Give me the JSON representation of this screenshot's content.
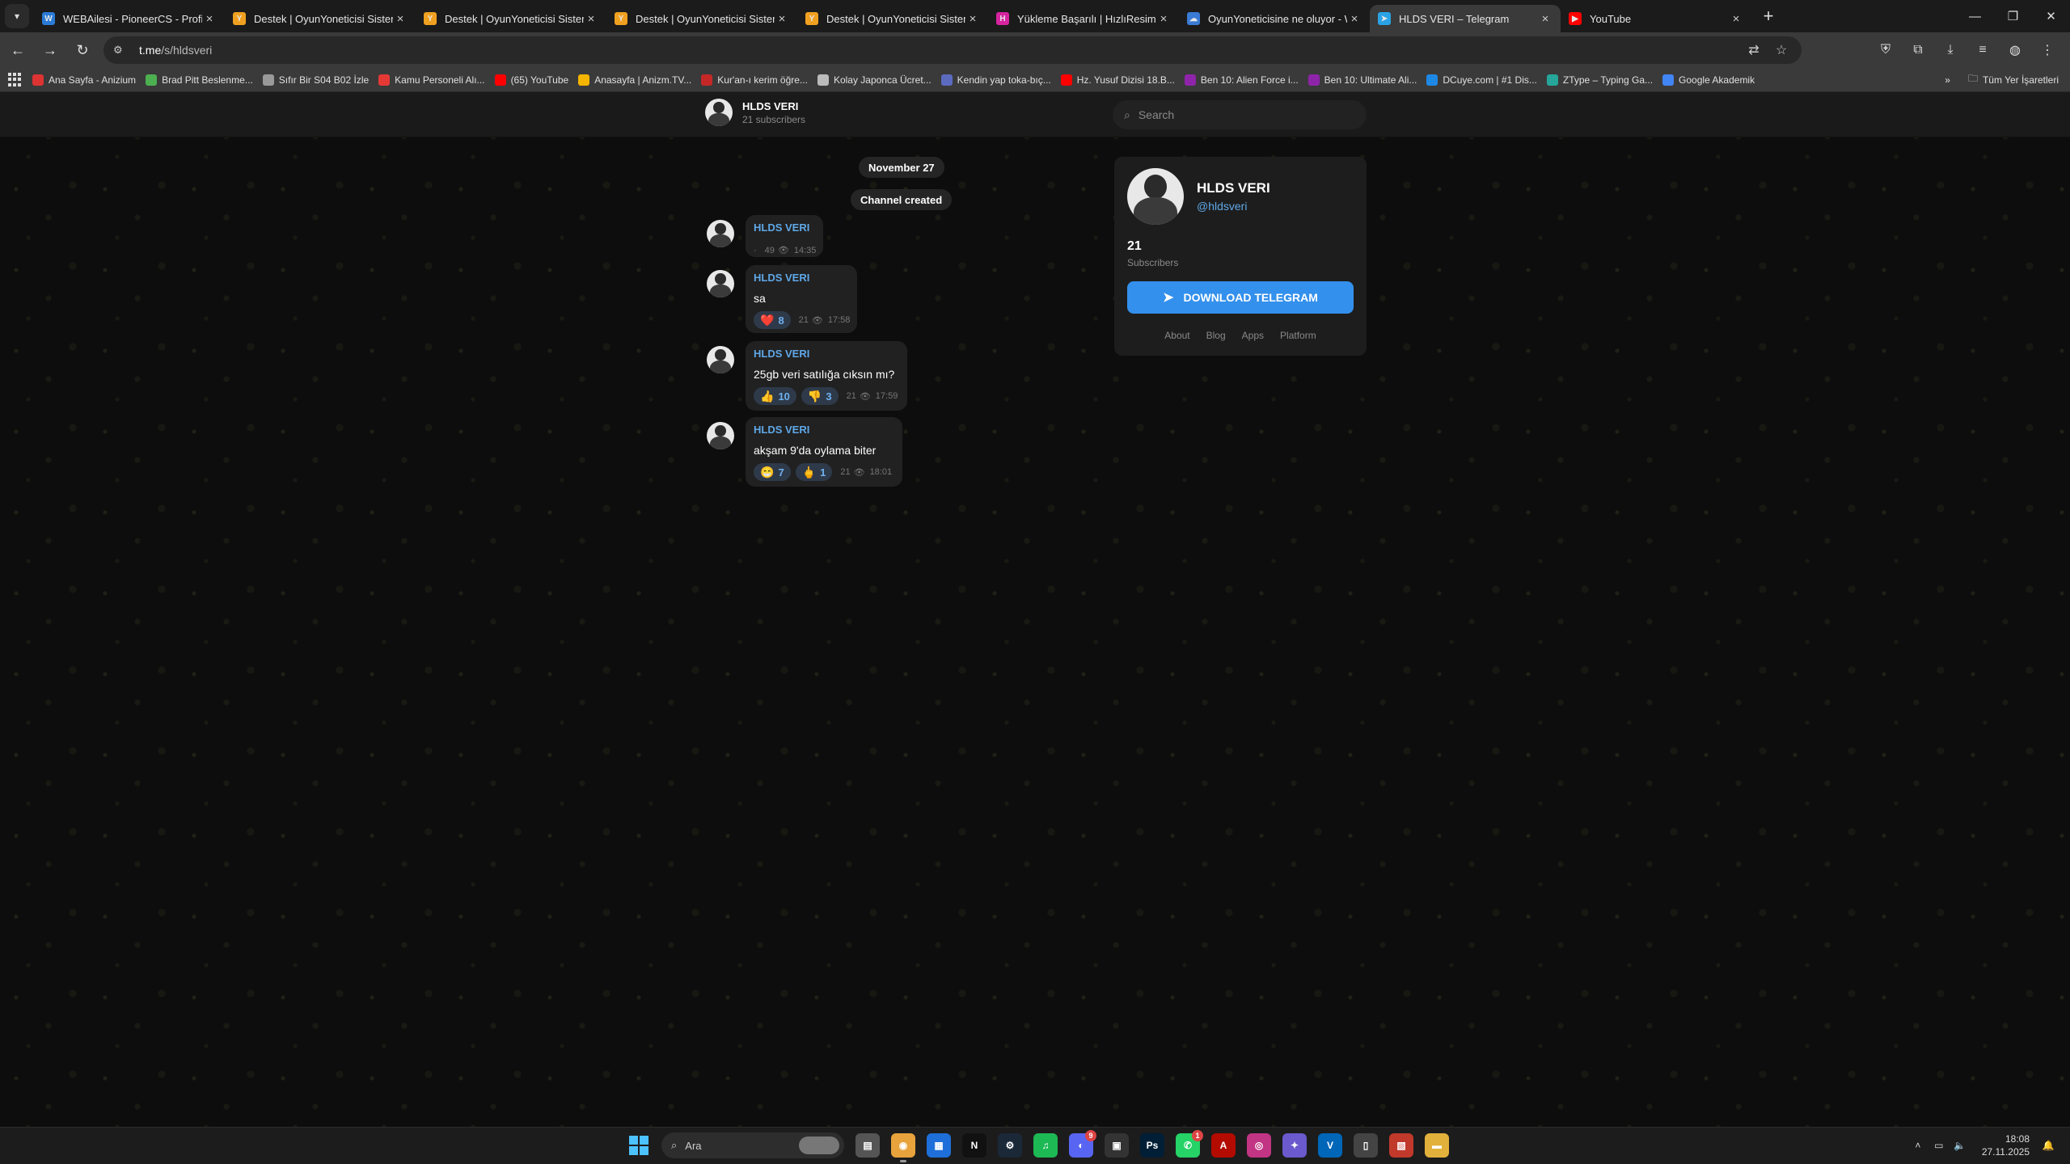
{
  "browser": {
    "tabs": [
      {
        "title": "WEBAilesi - PioneerCS - Profil S",
        "fav_color": "#2b7bd6",
        "fav_glyph": "W"
      },
      {
        "title": "Destek | OyunYoneticisi Sistemi",
        "fav_color": "#f0a020",
        "fav_glyph": "Y"
      },
      {
        "title": "Destek | OyunYoneticisi Sistemi",
        "fav_color": "#f0a020",
        "fav_glyph": "Y"
      },
      {
        "title": "Destek | OyunYoneticisi Sistemi",
        "fav_color": "#f0a020",
        "fav_glyph": "Y"
      },
      {
        "title": "Destek | OyunYoneticisi Sistemi",
        "fav_color": "#f0a020",
        "fav_glyph": "Y"
      },
      {
        "title": "Yükleme Başarılı | HızlıResim",
        "fav_color": "#d6249f",
        "fav_glyph": "H"
      },
      {
        "title": "OyunYoneticisine ne oluyor - W",
        "fav_color": "#3a7bd5",
        "fav_glyph": "☁"
      },
      {
        "title": "HLDS VERI – Telegram",
        "fav_color": "#2aa3e6",
        "fav_glyph": "➤",
        "active": true
      },
      {
        "title": "YouTube",
        "fav_color": "#ff0000",
        "fav_glyph": "▶"
      }
    ],
    "address": {
      "host": "t.me",
      "path": "/s/hldsveri"
    },
    "bookmarks": [
      {
        "label": "Ana Sayfa - Anizium",
        "color": "#d33"
      },
      {
        "label": "Brad Pitt Beslenme...",
        "color": "#4caf50"
      },
      {
        "label": "Sıfır Bir S04 B02 İzle",
        "color": "#999"
      },
      {
        "label": "Kamu Personeli Alı...",
        "color": "#e53935"
      },
      {
        "label": "(65) YouTube",
        "color": "#ff0000"
      },
      {
        "label": "Anasayfa | Anizm.TV...",
        "color": "#f4b400"
      },
      {
        "label": "Kur'an-ı kerim öğre...",
        "color": "#c62828"
      },
      {
        "label": "Kolay Japonca Ücret...",
        "color": "#bbb"
      },
      {
        "label": "Kendin yap toka-bıç...",
        "color": "#5c6bc0"
      },
      {
        "label": "Hz. Yusuf Dizisi 18.B...",
        "color": "#ff0000"
      },
      {
        "label": "Ben 10: Alien Force i...",
        "color": "#8e24aa"
      },
      {
        "label": "Ben 10: Ultimate Ali...",
        "color": "#8e24aa"
      },
      {
        "label": "DCuye.com | #1 Dis...",
        "color": "#1e88e5"
      },
      {
        "label": "ZType – Typing Ga...",
        "color": "#26a69a"
      },
      {
        "label": "Google Akademik",
        "color": "#4285f4"
      }
    ],
    "bookmarks_folder": "Tüm Yer İşaretleri"
  },
  "telegram": {
    "header": {
      "name": "HLDS VERI",
      "subscribers": "21 subscribers"
    },
    "search_placeholder": "Search",
    "date_label": "November 27",
    "service_label": "Channel created",
    "messages": [
      {
        "author": "HLDS VERI",
        "text": "",
        "reactions": [],
        "views": "49",
        "time": "14:35",
        "prefix": "·"
      },
      {
        "author": "HLDS VERI",
        "text": "sa",
        "reactions": [
          {
            "emoji": "❤️",
            "count": "8"
          }
        ],
        "views": "21",
        "time": "17:58"
      },
      {
        "author": "HLDS VERI",
        "text": "25gb veri satılığa cıksın mı?",
        "reactions": [
          {
            "emoji": "👍",
            "count": "10"
          },
          {
            "emoji": "👎",
            "count": "3"
          }
        ],
        "views": "21",
        "time": "17:59"
      },
      {
        "author": "HLDS VERI",
        "text": "akşam 9'da oylama biter",
        "reactions": [
          {
            "emoji": "😁",
            "count": "7"
          },
          {
            "emoji": "🖕",
            "count": "1"
          }
        ],
        "views": "21",
        "time": "18:01"
      }
    ],
    "card": {
      "name": "HLDS VERI",
      "handle": "@hldsveri",
      "count": "21",
      "count_label": "Subscribers",
      "download_label": "DOWNLOAD TELEGRAM",
      "links": [
        "About",
        "Blog",
        "Apps",
        "Platform"
      ]
    }
  },
  "taskbar": {
    "search_label": "Ara",
    "time": "18:08",
    "date": "27.11.2025",
    "apps": [
      {
        "name": "file-explorer",
        "color": "#555",
        "glyph": "▤"
      },
      {
        "name": "chrome",
        "color": "#e8a33c",
        "glyph": "◉",
        "active": true
      },
      {
        "name": "calendar-app",
        "color": "#1e6fd9",
        "glyph": "▦"
      },
      {
        "name": "netflix",
        "color": "#111",
        "glyph": "N"
      },
      {
        "name": "steam",
        "color": "#1b2838",
        "glyph": "⚙"
      },
      {
        "name": "spotify",
        "color": "#1db954",
        "glyph": "♫"
      },
      {
        "name": "discord",
        "color": "#5865f2",
        "glyph": "◐",
        "badge": "9"
      },
      {
        "name": "store",
        "color": "#333",
        "glyph": "▣"
      },
      {
        "name": "photoshop",
        "color": "#001e36",
        "glyph": "Ps"
      },
      {
        "name": "whatsapp",
        "color": "#25d366",
        "glyph": "✆",
        "badge": "1"
      },
      {
        "name": "acrobat",
        "color": "#b30b00",
        "glyph": "A"
      },
      {
        "name": "instagram",
        "color": "#c13584",
        "glyph": "◎"
      },
      {
        "name": "copilot",
        "color": "#6a5acd",
        "glyph": "✦"
      },
      {
        "name": "vs-code",
        "color": "#0066b8",
        "glyph": "V"
      },
      {
        "name": "notes",
        "color": "#444",
        "glyph": "▯"
      },
      {
        "name": "photos",
        "color": "#c0392b",
        "glyph": "▧"
      },
      {
        "name": "folder",
        "color": "#e2b13c",
        "glyph": "▬"
      }
    ]
  }
}
